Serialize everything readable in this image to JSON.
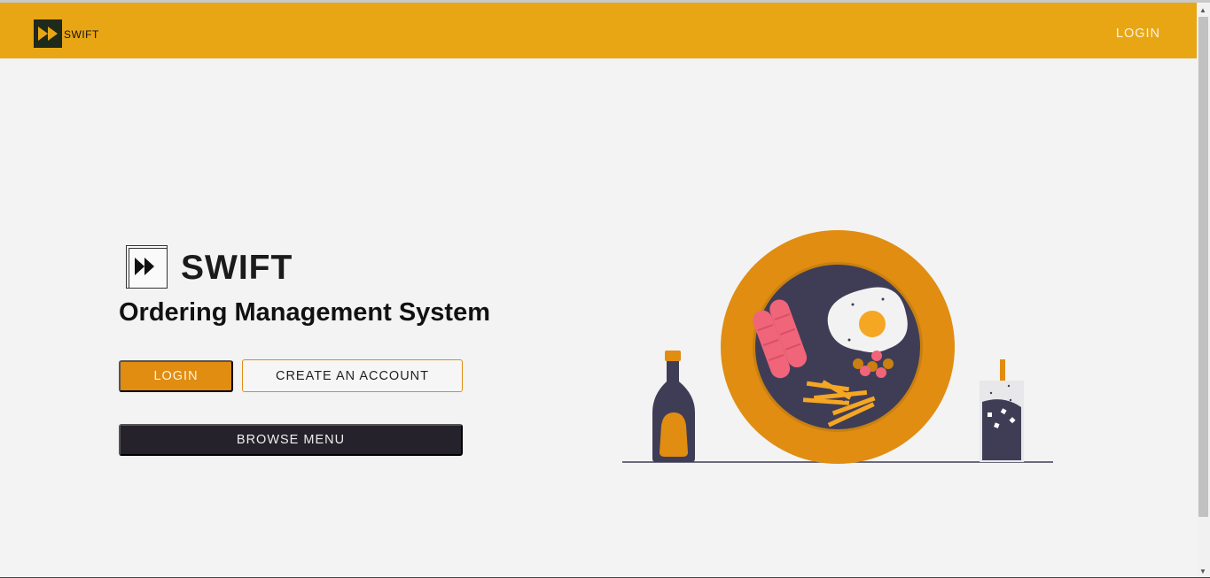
{
  "navbar": {
    "logo_text": "SWIFT",
    "login_label": "LOGIN"
  },
  "hero": {
    "brand_name": "SWIFT",
    "subtitle": "Ordering Management System",
    "login_button": "LOGIN",
    "create_account_button": "CREATE AN ACCOUNT",
    "browse_menu_button": "BROWSE MENU"
  },
  "icons": {
    "logo": "fast-forward-icon",
    "illustration": "food-plate-illustration"
  },
  "colors": {
    "navbar": "#e8a615",
    "primary": "#e08d12",
    "dark": "#25222b",
    "background": "#f3f3f3"
  }
}
